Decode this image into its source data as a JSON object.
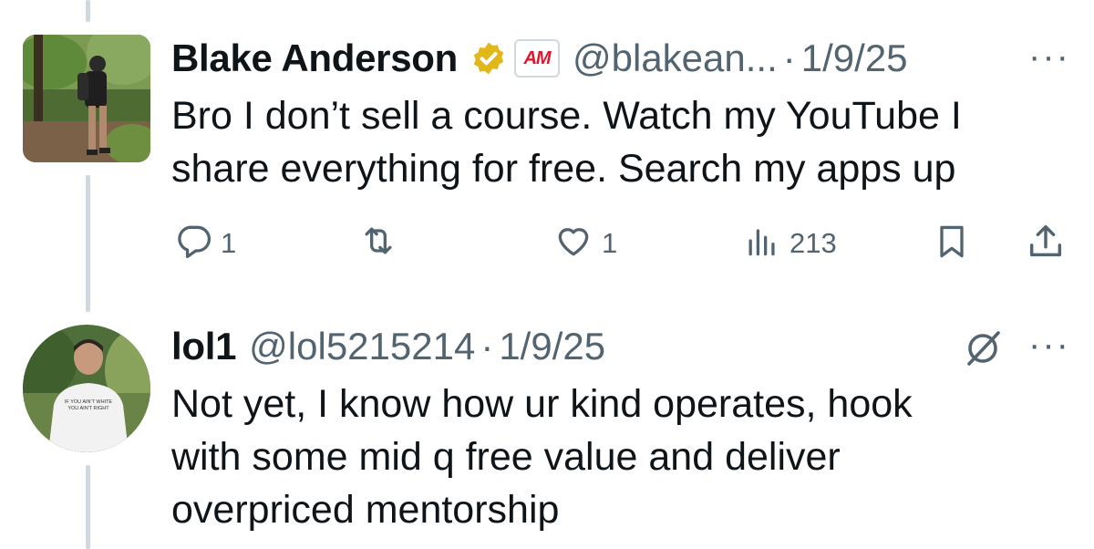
{
  "tweets": [
    {
      "name": "Blake Anderson",
      "handle": "@blakean...",
      "separator": "·",
      "date": "1/9/25",
      "badge": "AM",
      "text_lines": [
        "Bro I don’t sell a course.  Watch my YouTube I",
        "share everything for free.  Search my apps up"
      ],
      "replies": "1",
      "retweets": "",
      "likes": "1",
      "views": "213",
      "more": "···"
    },
    {
      "name": "lol1",
      "handle": "@lol5215214",
      "separator": "·",
      "date": "1/9/25",
      "avatar_shirt_text": "IF YOU AIN'T WHITE YOU AIN'T RIGHT",
      "text_lines": [
        "Not yet, I know how ur kind operates, hook",
        "with some mid q free value and deliver",
        "overpriced mentorship"
      ],
      "more": "···"
    }
  ],
  "colors": {
    "text": "#0f1419",
    "muted": "#536471",
    "thread_line": "#cfd9de",
    "verified_gold": "#e2b719"
  },
  "icons": [
    "reply-icon",
    "retweet-icon",
    "like-icon",
    "views-icon",
    "bookmark-icon",
    "share-icon",
    "verified-badge-icon",
    "grok-icon",
    "more-icon"
  ]
}
